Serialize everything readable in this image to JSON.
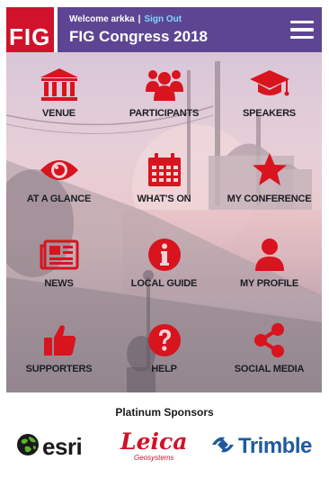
{
  "header": {
    "logo_text": "FIG",
    "welcome": "Welcome arkka",
    "separator": "|",
    "sign_out": "Sign Out",
    "title": "FIG Congress 2018",
    "menu_icon": "hamburger-menu-icon"
  },
  "colors": {
    "header_bg": "#5d4593",
    "logo_red": "#d0122a",
    "icon_red": "#d8141f",
    "sign_out_link": "#7fd7ff"
  },
  "tiles": [
    {
      "label": "VENUE",
      "icon": "building-columns-icon"
    },
    {
      "label": "PARTICIPANTS",
      "icon": "people-group-icon"
    },
    {
      "label": "SPEAKERS",
      "icon": "graduation-cap-icon"
    },
    {
      "label": "AT A GLANCE",
      "icon": "eye-icon"
    },
    {
      "label": "WHAT'S ON",
      "icon": "calendar-icon"
    },
    {
      "label": "MY CONFERENCE",
      "icon": "star-icon"
    },
    {
      "label": "NEWS",
      "icon": "newspaper-icon"
    },
    {
      "label": "LOCAL GUIDE",
      "icon": "info-circle-icon"
    },
    {
      "label": "MY PROFILE",
      "icon": "user-icon"
    },
    {
      "label": "SUPPORTERS",
      "icon": "thumbs-up-icon"
    },
    {
      "label": "HELP",
      "icon": "question-circle-icon"
    },
    {
      "label": "SOCIAL MEDIA",
      "icon": "share-icon"
    }
  ],
  "sponsors": {
    "title": "Platinum Sponsors",
    "items": [
      {
        "name": "esri",
        "icon": "globe-icon"
      },
      {
        "name": "Leica",
        "subtitle": "Geosystems"
      },
      {
        "name": "Trimble",
        "icon": "trimble-logo-icon"
      }
    ]
  }
}
